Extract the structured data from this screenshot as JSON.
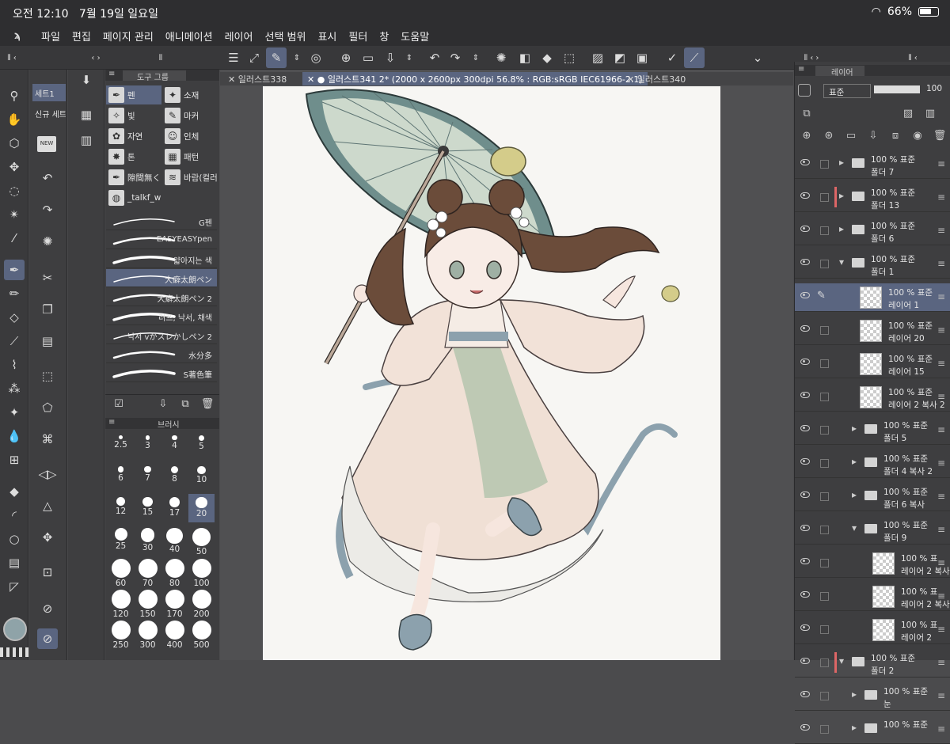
{
  "status": {
    "time": "오전 12:10",
    "date": "7월 19일 일요일",
    "battery": "66%",
    "battery_level": 0.66
  },
  "menu": [
    "파일",
    "편집",
    "페이지 관리",
    "애니메이션",
    "레이어",
    "선택 범위",
    "표시",
    "필터",
    "창",
    "도움말"
  ],
  "set_panel": {
    "tab": "세트1",
    "item": "신규 세트",
    "new_badge": "NEW"
  },
  "subtool_header": "도구 그룹",
  "tool_groups": [
    {
      "label": "펜",
      "icon": "pen-icon",
      "active": true
    },
    {
      "label": "소재",
      "icon": "material-icon"
    },
    {
      "label": "빛",
      "icon": "sparkle-icon"
    },
    {
      "label": "마커",
      "icon": "marker-icon"
    },
    {
      "label": "자연",
      "icon": "flower-icon"
    },
    {
      "label": "인체",
      "icon": "figure-icon"
    },
    {
      "label": "톤",
      "icon": "tone-icon"
    },
    {
      "label": "패턴",
      "icon": "pattern-icon"
    },
    {
      "label": "隙間無く",
      "icon": "gap-pen-icon"
    },
    {
      "label": "바람(컬러",
      "icon": "wind-icon"
    },
    {
      "label": "_talkf_w",
      "icon": "custom-icon"
    }
  ],
  "brushes": [
    {
      "label": "G펜"
    },
    {
      "label": "EASYEASYpen"
    },
    {
      "label": "얇아지는 색"
    },
    {
      "label": "大癖太朗ペン",
      "active": true
    },
    {
      "label": "大癖太朗ペン 2"
    },
    {
      "label": "러프, 낙서, 채색"
    },
    {
      "label": "낙서 vかスレかしペン 2"
    },
    {
      "label": "水分多"
    },
    {
      "label": "S著色筆"
    }
  ],
  "brush_size_header": "브러시",
  "brush_sizes": [
    "2.5",
    "3",
    "4",
    "5",
    "6",
    "7",
    "8",
    "10",
    "12",
    "15",
    "17",
    "20",
    "25",
    "30",
    "40",
    "50",
    "60",
    "70",
    "80",
    "100",
    "120",
    "150",
    "170",
    "200",
    "250",
    "300",
    "400",
    "500"
  ],
  "active_size": "20",
  "tabs": [
    "일러스트338",
    "● 일러스트341 2* (2000 x 2600px 300dpi 56.8% : RGB:sRGB IEC61966-2.1)",
    "일러스트340"
  ],
  "layer_panel": {
    "header": "레이어",
    "blend_mode": "표준",
    "opacity": "100",
    "layers": [
      {
        "pct": "100 % 표준",
        "name": "폴더 7",
        "type": "folder",
        "indent": 0,
        "arrow": "▸"
      },
      {
        "pct": "100 % 표준",
        "name": "폴더 13",
        "type": "folder",
        "indent": 0,
        "arrow": "▸",
        "red": true
      },
      {
        "pct": "100 % 표준",
        "name": "폴더 6",
        "type": "folder",
        "indent": 0,
        "arrow": "▸"
      },
      {
        "pct": "100 % 표준",
        "name": "폴더 1",
        "type": "folder",
        "indent": 0,
        "arrow": "▾"
      },
      {
        "pct": "100 % 표준",
        "name": "레이어 1",
        "type": "layer",
        "indent": 1,
        "active": true
      },
      {
        "pct": "100 % 표준",
        "name": "레이어 20",
        "type": "layer",
        "indent": 1
      },
      {
        "pct": "100 % 표준",
        "name": "레이어 15",
        "type": "layer",
        "indent": 1
      },
      {
        "pct": "100 % 표준",
        "name": "레이어 2 복사 2",
        "type": "layer",
        "indent": 1
      },
      {
        "pct": "100 % 표준",
        "name": "폴더 5",
        "type": "folder",
        "indent": 1,
        "arrow": "▸"
      },
      {
        "pct": "100 % 표준",
        "name": "폴더 4 복사 2",
        "type": "folder",
        "indent": 1,
        "arrow": "▸"
      },
      {
        "pct": "100 % 표준",
        "name": "폴더 6 복사",
        "type": "folder",
        "indent": 1,
        "arrow": "▸"
      },
      {
        "pct": "100 % 표준",
        "name": "폴더 9",
        "type": "folder",
        "indent": 1,
        "arrow": "▾"
      },
      {
        "pct": "100 % 표",
        "name": "레이어 2 복사",
        "type": "layer",
        "indent": 2
      },
      {
        "pct": "100 % 표",
        "name": "레이어 2 복사",
        "type": "layer",
        "indent": 2
      },
      {
        "pct": "100 % 표",
        "name": "레이어 2",
        "type": "layer",
        "indent": 2
      },
      {
        "pct": "100 % 표준",
        "name": "폴더 2",
        "type": "folder",
        "indent": 0,
        "arrow": "▾",
        "red": true
      },
      {
        "pct": "100 % 표준",
        "name": "눈",
        "type": "folder",
        "indent": 1,
        "arrow": "▸"
      },
      {
        "pct": "100 % 표준",
        "name": "",
        "type": "folder",
        "indent": 1,
        "arrow": "▸"
      }
    ]
  }
}
